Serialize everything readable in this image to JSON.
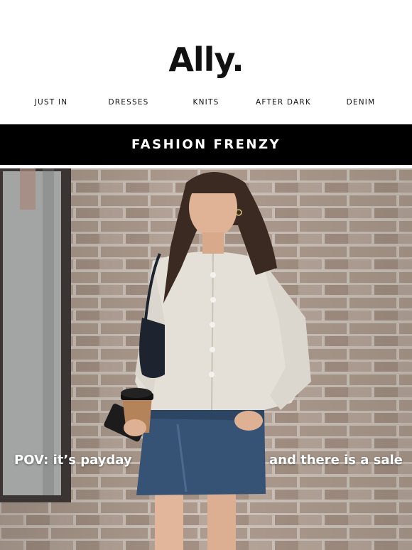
{
  "brand": {
    "logo_text": "Ally."
  },
  "nav": {
    "items": [
      {
        "label": "JUST IN"
      },
      {
        "label": "DRESSES"
      },
      {
        "label": "KNITS"
      },
      {
        "label": "AFTER DARK"
      },
      {
        "label": "DENIM"
      }
    ]
  },
  "banner": {
    "text": "FASHION FRENZY"
  },
  "hero": {
    "caption_left": "POV: it’s payday",
    "caption_right": "and there is a sale"
  },
  "colors": {
    "banner_bg": "#000000",
    "banner_text": "#ffffff",
    "nav_text": "#111111",
    "brick": "#a99789",
    "mortar": "#cfc6bd"
  }
}
